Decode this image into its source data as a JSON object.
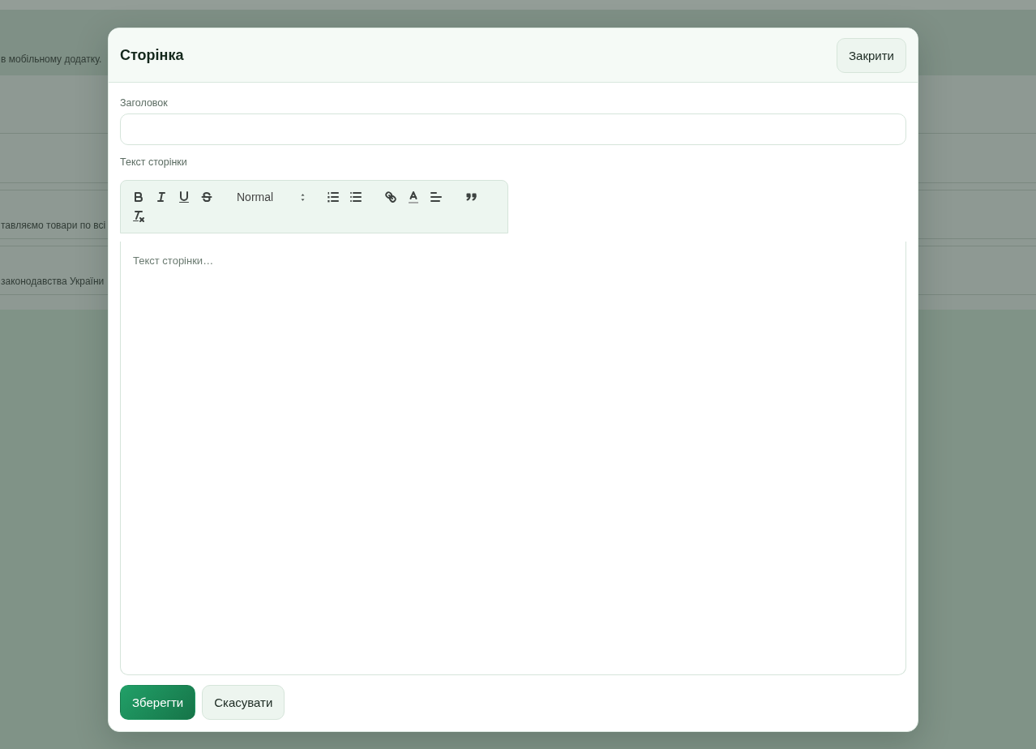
{
  "background": {
    "notice": "в мобільному додатку.",
    "rows": [
      "тавляємо товари по всі",
      "законодавства України"
    ]
  },
  "dialog": {
    "title": "Сторінка",
    "close_button": "Закрити",
    "title_field": {
      "label": "Заголовок"
    },
    "content_field": {
      "label": "Текст сторінки",
      "toolbar": [
        {
          "items": [
            {
              "kind": "bold"
            },
            {
              "kind": "italic"
            },
            {
              "kind": "underline"
            },
            {
              "kind": "strike"
            }
          ]
        },
        {
          "items": [
            {
              "kind": "header",
              "value": "Normal"
            }
          ]
        },
        {
          "items": [
            {
              "kind": "ordered_list"
            },
            {
              "kind": "bullet_list"
            }
          ]
        },
        {
          "items": [
            {
              "kind": "link"
            },
            {
              "kind": "color"
            },
            {
              "kind": "align"
            }
          ]
        },
        {
          "items": [
            {
              "kind": "blockquote"
            }
          ]
        },
        {
          "items": [
            {
              "kind": "clean"
            }
          ]
        }
      ],
      "placeholder": "Текст сторінки…"
    },
    "buttons": [
      {
        "label": "Зберегти",
        "kind": "primary"
      },
      {
        "label": "Скасувати",
        "kind": "secondary"
      }
    ]
  }
}
